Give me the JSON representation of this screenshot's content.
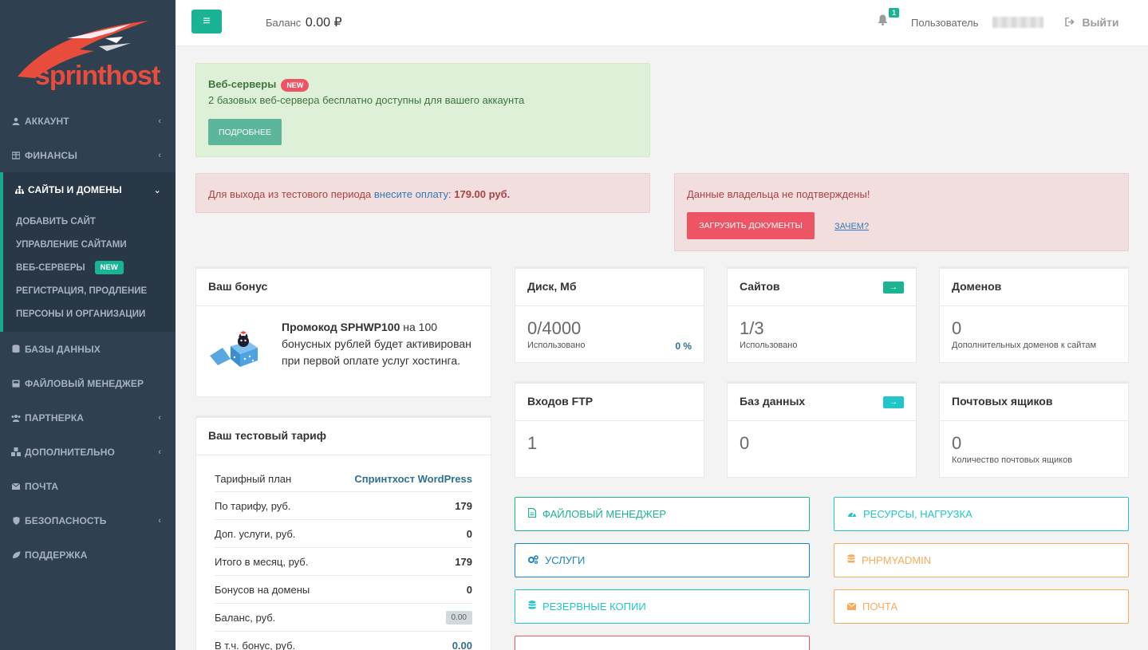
{
  "sidebar": {
    "logo_text": "sprinthost",
    "items": [
      {
        "label": "Аккаунт",
        "icon": "user-icon",
        "chevron": true
      },
      {
        "label": "Финансы",
        "icon": "finance-icon",
        "chevron": true
      },
      {
        "label": "Сайты и домены",
        "icon": "sitemap-icon",
        "chevron": true,
        "active": true
      },
      {
        "label": "Базы данных",
        "icon": "database-icon"
      },
      {
        "label": "Файловый менеджер",
        "icon": "file-icon"
      },
      {
        "label": "Партнерка",
        "icon": "users-icon",
        "chevron": true
      },
      {
        "label": "Дополнительно",
        "icon": "cubes-icon",
        "chevron": true
      },
      {
        "label": "Почта",
        "icon": "envelope-icon"
      },
      {
        "label": "Безопасность",
        "icon": "shield-icon",
        "chevron": true
      },
      {
        "label": "Поддержка",
        "icon": "leaf-icon"
      }
    ],
    "submenu": [
      {
        "label": "Добавить сайт"
      },
      {
        "label": "Управление сайтами"
      },
      {
        "label": "Веб-серверы",
        "badge": "NEW"
      },
      {
        "label": "Регистрация, продление"
      },
      {
        "label": "Персоны и организации"
      }
    ]
  },
  "topbar": {
    "balance_label": "Баланс",
    "balance_value": "0.00 ₽",
    "notifications_count": "1",
    "user_label": "Пользователь",
    "logout_label": "Выйти"
  },
  "alerts": {
    "webservers": {
      "title": "Веб-серверы",
      "badge": "NEW",
      "text": "2 базовых веб-сервера бесплатно доступны для вашего аккаунта",
      "button": "Подробнее"
    },
    "payment": {
      "prefix": "Для выхода из тестового периода ",
      "link": "внесите оплату",
      "colon": ": ",
      "amount": "179.00 руб."
    },
    "owner": {
      "text": "Данные владельца не подтверждены!",
      "button": "Загрузить документы",
      "link": "Зачем?"
    }
  },
  "bonus": {
    "title": "Ваш бонус",
    "promo": "Промокод SPHWP100",
    "text": " на 100 бонусных рублей будет активирован при первой оплате услуг хостинга."
  },
  "tariff": {
    "title": "Ваш тестовый тариф",
    "rows": [
      {
        "label": "Тарифный план",
        "value": "Спринтхост WordPress"
      },
      {
        "label": "По тарифу, руб.",
        "value": "179"
      },
      {
        "label": "Доп. услуги, руб.",
        "value": "0"
      },
      {
        "label": "Итого в месяц, руб.",
        "value": "179"
      },
      {
        "label": "Бонусов на домены",
        "value": "0"
      },
      {
        "label": "Баланс, руб.",
        "value": "0.00"
      },
      {
        "label": "В т.ч. бонус, руб.",
        "value": "0.00"
      }
    ]
  },
  "stats": {
    "disk": {
      "title": "Диск, Мб",
      "value": "0/4000",
      "label": "Использовано",
      "percent": "0 %"
    },
    "sites": {
      "title": "Сайтов",
      "value": "1/3",
      "label": "Использовано",
      "arrow": "→"
    },
    "domains": {
      "title": "Доменов",
      "value": "0",
      "label": "Дополнительных доменов к сайтам"
    },
    "ftp": {
      "title": "Входов FTP",
      "value": "1"
    },
    "db": {
      "title": "Баз данных",
      "value": "0",
      "arrow": "→"
    },
    "mail": {
      "title": "Почтовых ящиков",
      "value": "0",
      "label": "Количество почтовых ящиков"
    }
  },
  "quick": {
    "file_manager": "Файловый менеджер",
    "resources": "Ресурсы, нагрузка",
    "services": "Услуги",
    "phpmyadmin": "phpMyAdmin",
    "backups": "Резервные копии",
    "mail": "Почта"
  },
  "colors": {
    "sidebar_bg": "#2f4050",
    "accent_green": "#1ab394",
    "danger": "#ed5565",
    "warning": "#f8ac59",
    "info": "#23c6c8",
    "primary_blue": "#1c84c6"
  }
}
